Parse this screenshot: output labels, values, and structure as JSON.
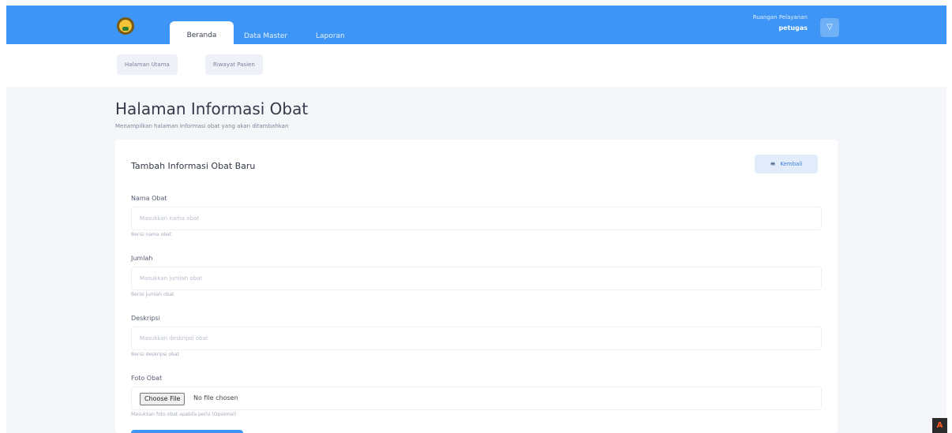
{
  "header": {
    "logo_icon": "emblem-icon",
    "nav": [
      {
        "label": "Beranda"
      },
      {
        "label": "Data Master"
      },
      {
        "label": "Laporan"
      }
    ],
    "user_role": "Ruangan Pelayanan",
    "user_name": "petugas",
    "user_icon_glyph": "▽",
    "accent": "#3d95f5"
  },
  "subnav": [
    {
      "label": "Halaman Utama"
    },
    {
      "label": "Riwayat Pasien"
    }
  ],
  "page": {
    "title": "Halaman Informasi Obat",
    "subtitle": "Menampilkan halaman informasi obat yang akan ditambahkan"
  },
  "card": {
    "title": "Tambah Informasi Obat Baru",
    "back_label": "Kembali",
    "back_icon": "≡",
    "fields": [
      {
        "label": "Nama Obat",
        "placeholder": "Masukkan nama obat",
        "help": "Berisi nama obat"
      },
      {
        "label": "Jumlah",
        "placeholder": "Masukkan jumlah obat",
        "help": "Berisi jumlah obat"
      },
      {
        "label": "Deskripsi",
        "placeholder": "Masukkan deskripsi obat",
        "help": "Berisi deskripsi obat"
      }
    ],
    "file": {
      "label": "Foto Obat",
      "button_label": "Choose File",
      "status": "No file chosen",
      "help": "Masukkan foto obat apabila perlu (Opsional)"
    }
  },
  "corner_badge": "A"
}
